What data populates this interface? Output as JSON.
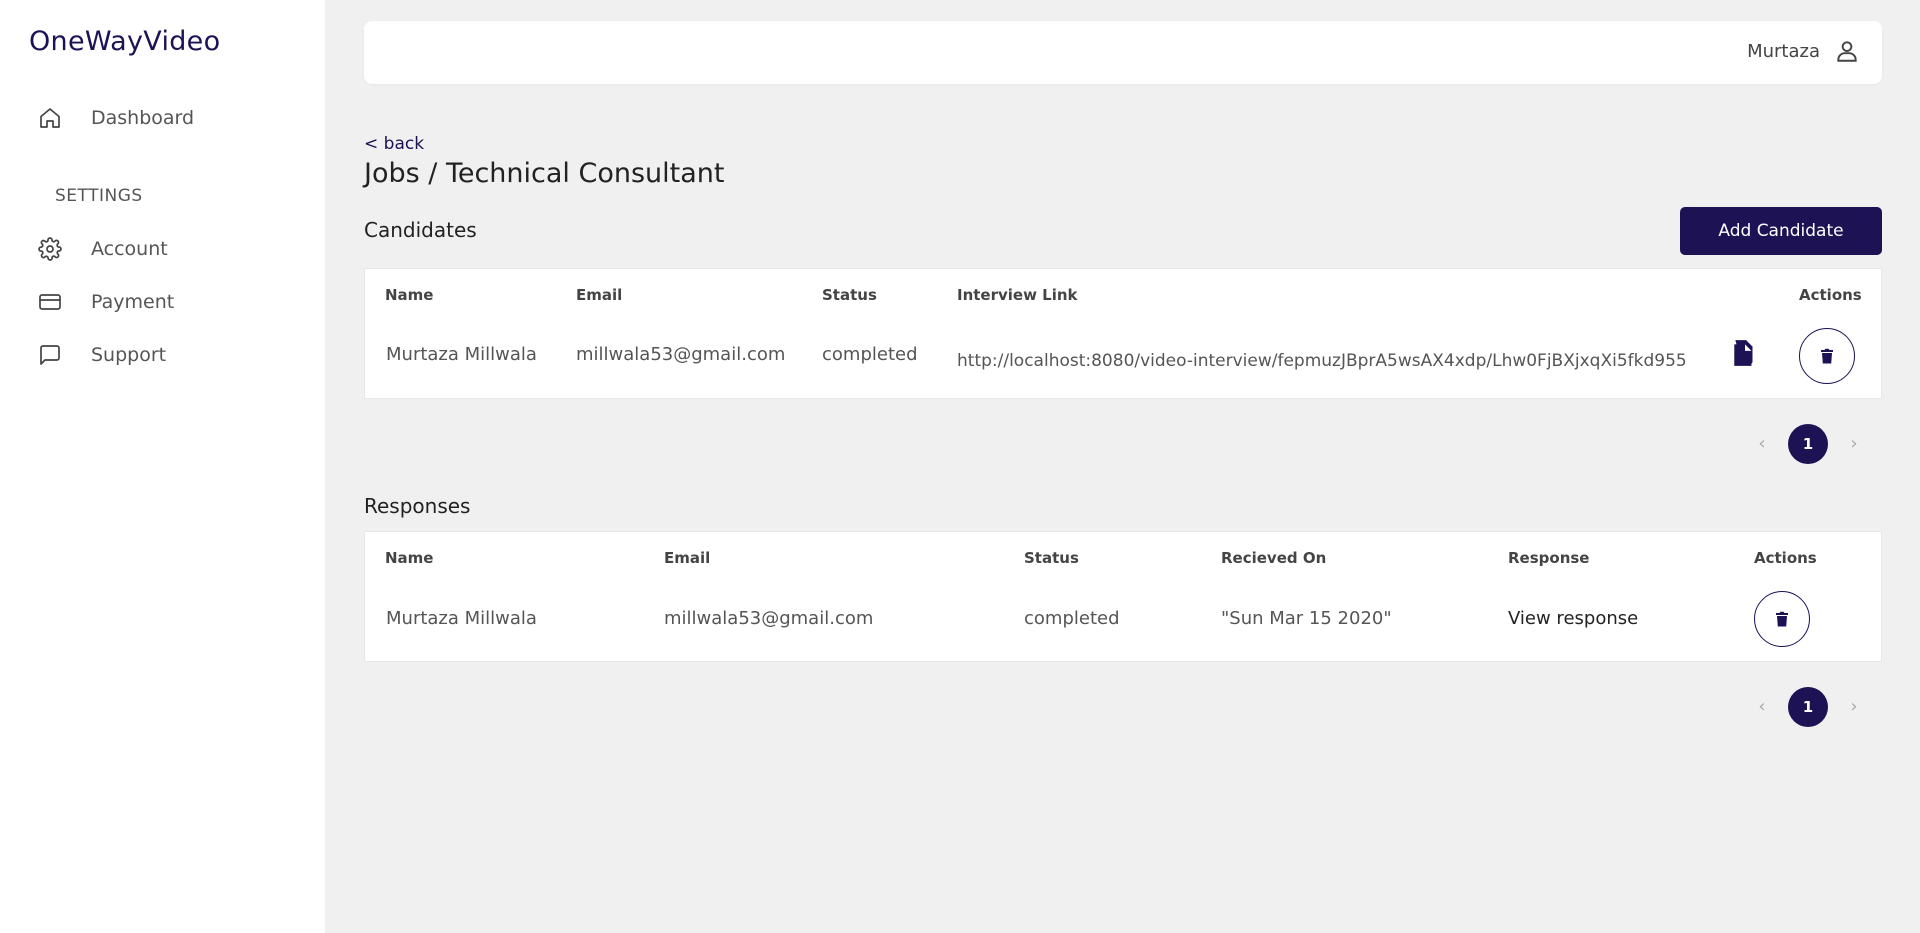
{
  "app": {
    "brand": "OneWayVideo"
  },
  "sidebar": {
    "dashboard": "Dashboard",
    "settings_heading": "SETTINGS",
    "account": "Account",
    "payment": "Payment",
    "support": "Support"
  },
  "header": {
    "user_name": "Murtaza"
  },
  "page": {
    "back_label": "< back",
    "title": "Jobs / Technical Consultant"
  },
  "candidates": {
    "title": "Candidates",
    "add_button": "Add Candidate",
    "columns": {
      "name": "Name",
      "email": "Email",
      "status": "Status",
      "link": "Interview Link",
      "actions": "Actions"
    },
    "rows": [
      {
        "name": "Murtaza Millwala",
        "email": "millwala53@gmail.com",
        "status": "completed",
        "link": "http://localhost:8080/video-interview/fepmuzJBprA5wsAX4xdp/Lhw0FjBXjxqXi5fkd955"
      }
    ],
    "pagination": {
      "prev": "‹",
      "current": "1",
      "next": "›"
    }
  },
  "responses": {
    "title": "Responses",
    "columns": {
      "name": "Name",
      "email": "Email",
      "status": "Status",
      "received": "Recieved On",
      "response": "Response",
      "actions": "Actions"
    },
    "rows": [
      {
        "name": "Murtaza Millwala",
        "email": "millwala53@gmail.com",
        "status": "completed",
        "received": "\"Sun Mar 15 2020\"",
        "response": "View response"
      }
    ],
    "pagination": {
      "prev": "‹",
      "current": "1",
      "next": "›"
    }
  },
  "colors": {
    "primary": "#1c1254",
    "background": "#f0f0f0",
    "card": "#ffffff"
  }
}
